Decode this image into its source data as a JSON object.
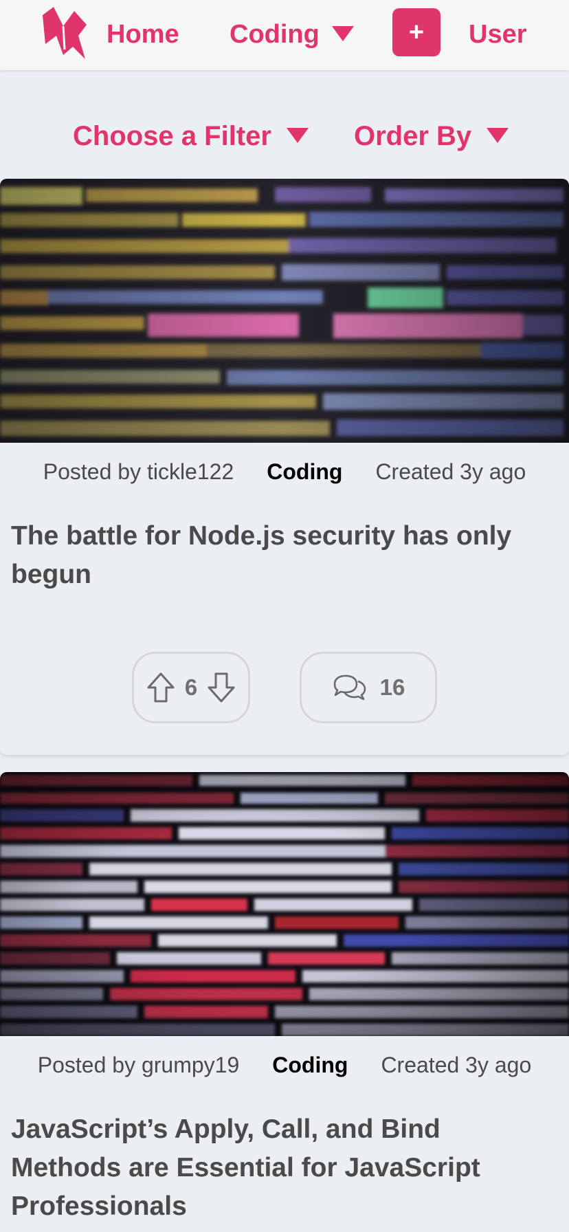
{
  "nav": {
    "home_label": "Home",
    "coding_label": "Coding",
    "add_label": "+",
    "user_label": "User"
  },
  "filters": {
    "choose_label": "Choose a Filter",
    "order_label": "Order By"
  },
  "colors": {
    "accent": "#e0356b",
    "background": "#ebeef2",
    "text": "#4a4a4a"
  },
  "posts": [
    {
      "author_text": "Posted by tickle122",
      "category": "Coding",
      "created_text": "Created 3y ago",
      "title": "The battle for Node.js security has only begun",
      "votes": "6",
      "comments": "16",
      "image_description_icon": "code-screen-image"
    },
    {
      "author_text": "Posted by grumpy19",
      "category": "Coding",
      "created_text": "Created 3y ago",
      "title": "JavaScript’s Apply, Call, and Bind Methods are Essential for JavaScript Professionals",
      "image_description_icon": "code-screen-image"
    }
  ]
}
